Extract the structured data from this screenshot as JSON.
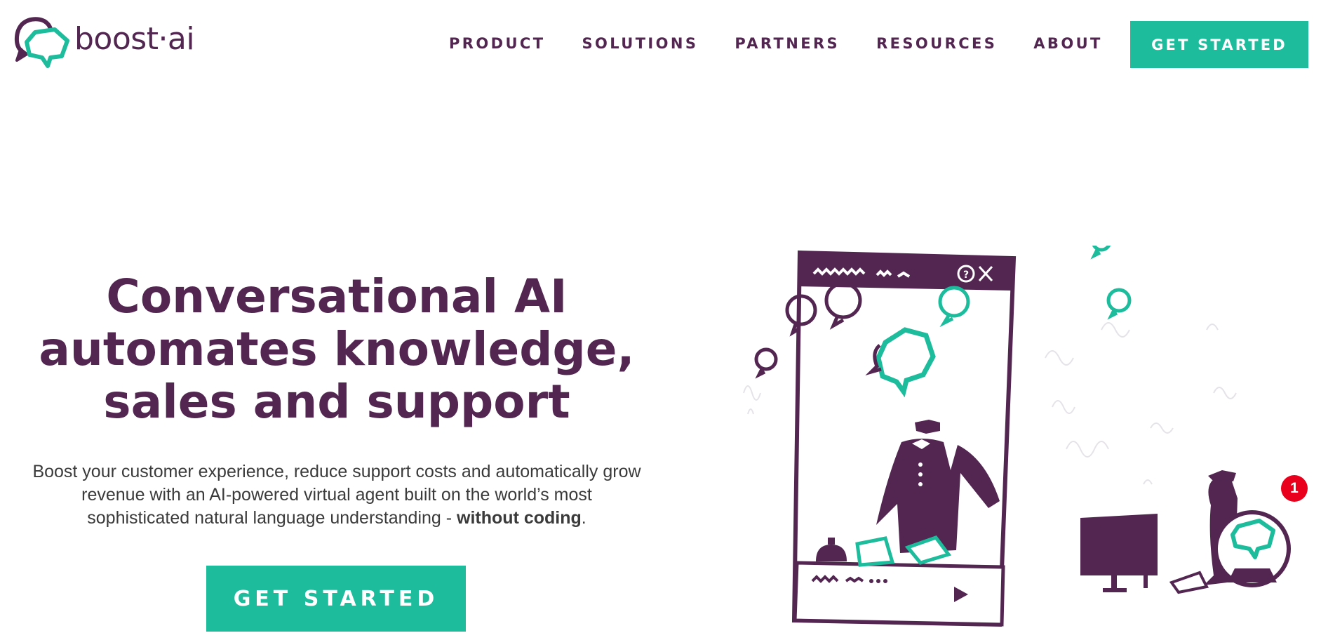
{
  "brand": {
    "name": "boost·ai",
    "logo_icon": "speech-bubbles-logo",
    "primary_color": "#522651",
    "accent_color": "#1dbc9c"
  },
  "nav": {
    "items": [
      {
        "label": "PRODUCT"
      },
      {
        "label": "SOLUTIONS"
      },
      {
        "label": "PARTNERS"
      },
      {
        "label": "RESOURCES"
      },
      {
        "label": "ABOUT"
      }
    ],
    "cta_label": "GET STARTED"
  },
  "hero": {
    "title_lines": [
      "Conversational AI",
      "automates knowledge,",
      "sales and support"
    ],
    "subtitle_prefix": "Boost your customer experience, reduce support costs and automatically grow revenue with an AI-powered virtual agent built on the world’s most sophisticated natural language understanding - ",
    "subtitle_bold": "without coding",
    "subtitle_suffix": ".",
    "cta_label": "GET STARTED"
  },
  "chat_widget": {
    "icon": "chat-bubble-icon",
    "notification_count": "1"
  },
  "illustration": {
    "description_icons": [
      "help-icon",
      "close-icon",
      "send-icon"
    ]
  }
}
